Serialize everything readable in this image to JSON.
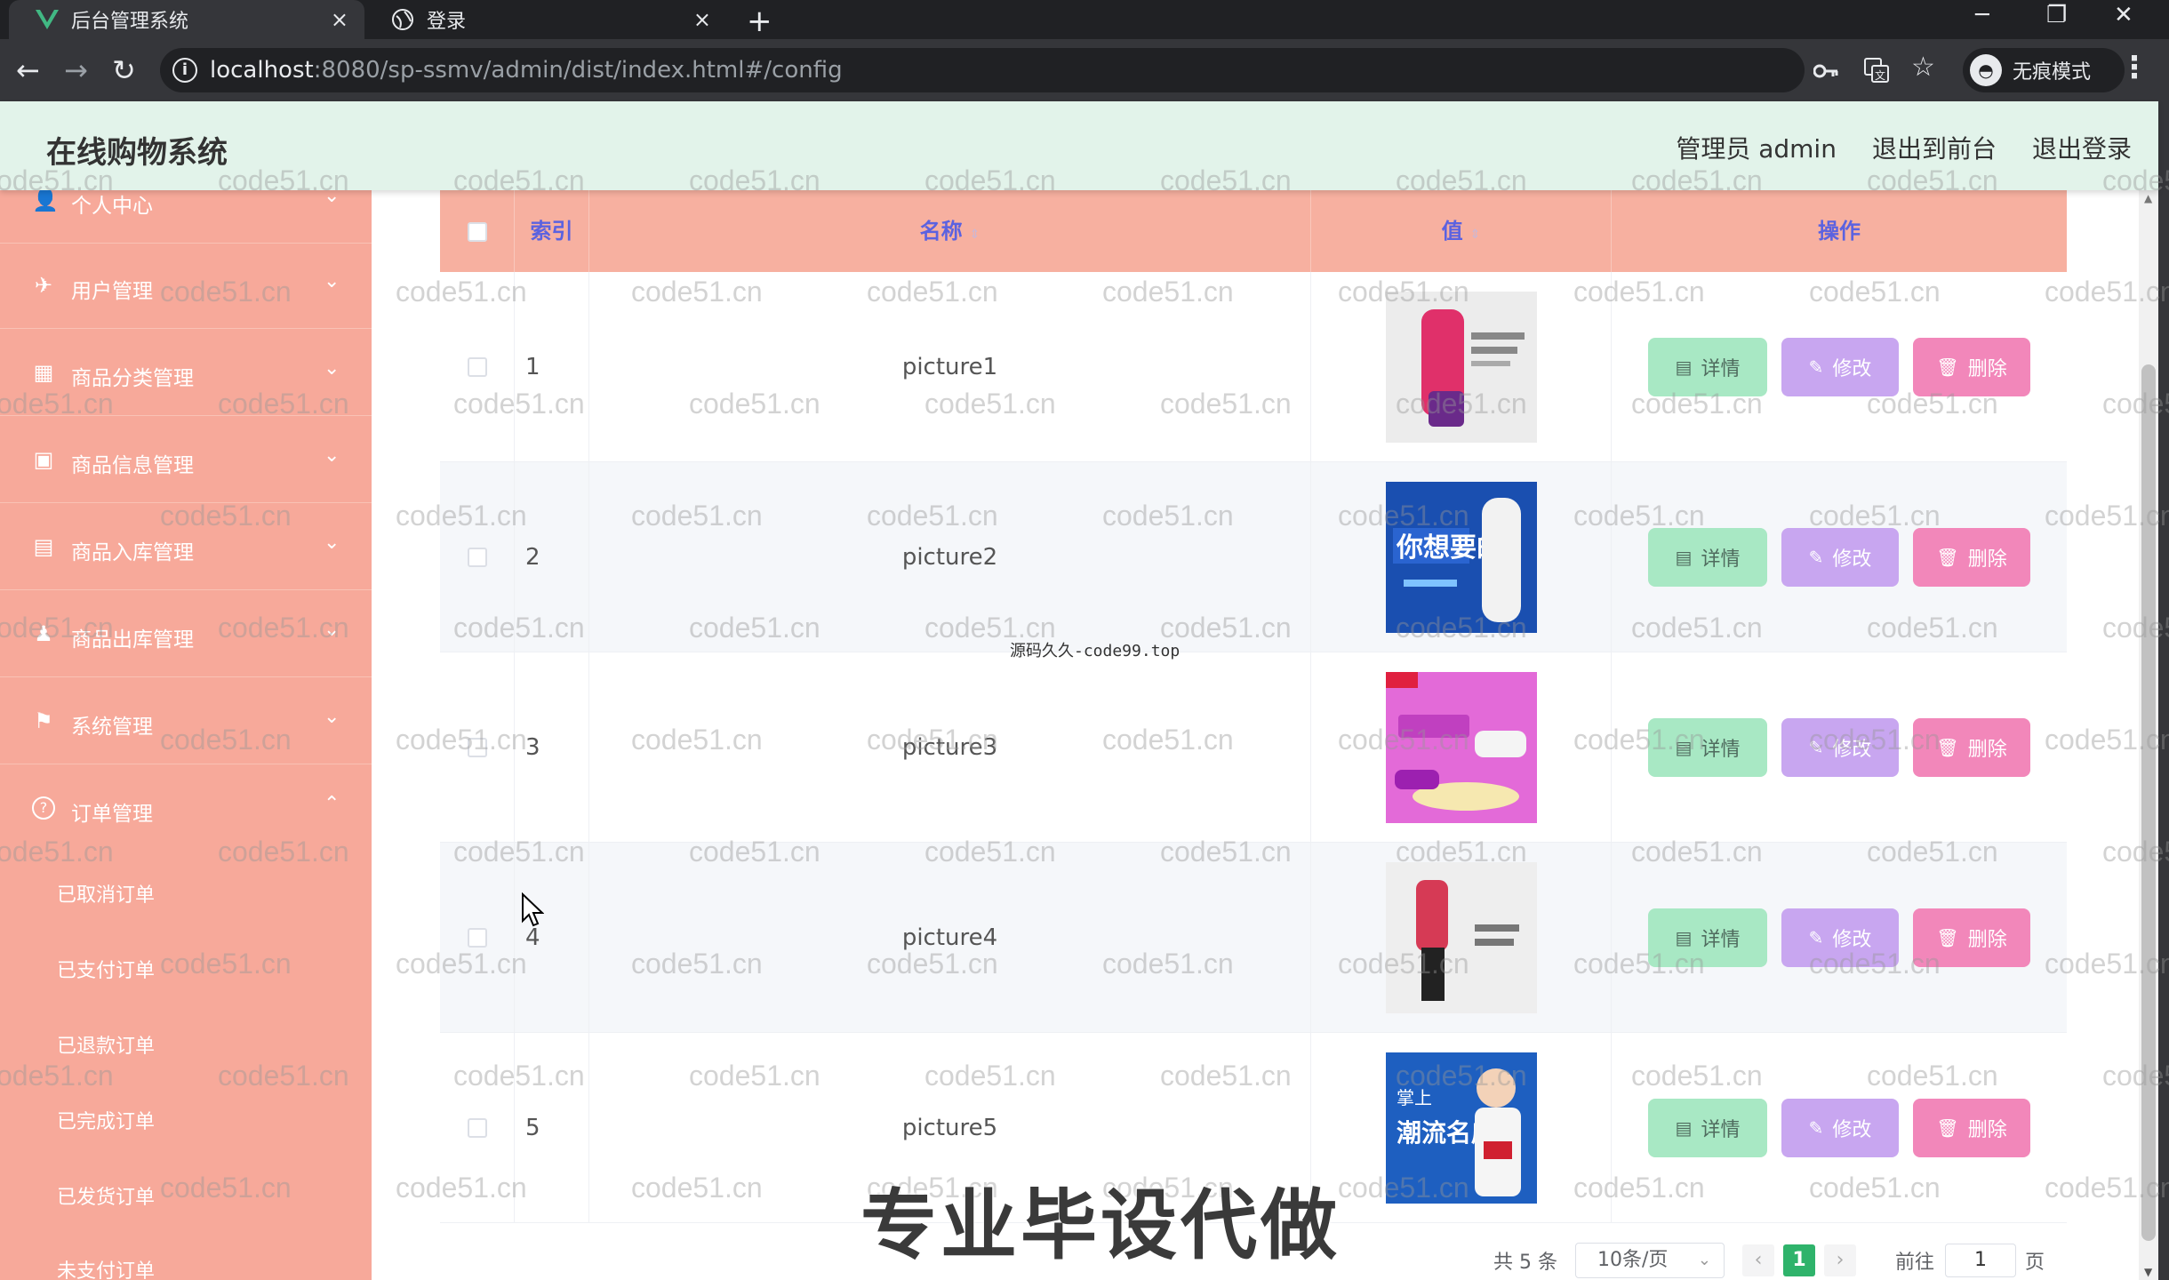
{
  "browser": {
    "tabs": [
      {
        "title": "后台管理系统",
        "close": "×"
      },
      {
        "title": "登录",
        "close": "×"
      }
    ],
    "new_tab": "+",
    "window": {
      "minimize": "─",
      "restore": "❐",
      "close": "✕"
    },
    "nav": {
      "back": "←",
      "forward": "→",
      "reload": "↻"
    },
    "url_host": "localhost",
    "url_rest": ":8080/sp-ssmv/admin/dist/index.html#/config",
    "incognito_label": "无痕模式"
  },
  "header": {
    "title": "在线购物系统",
    "links": [
      "管理员 admin",
      "退出到前台",
      "退出登录"
    ]
  },
  "sidebar": {
    "items": [
      {
        "label": "个人中心",
        "icon": "user-icon",
        "glyph": "👤",
        "chev": "⌄"
      },
      {
        "label": "用户管理",
        "icon": "send-icon",
        "glyph": "✈",
        "chev": "⌄"
      },
      {
        "label": "商品分类管理",
        "icon": "grid-icon",
        "glyph": "▦",
        "chev": "⌄"
      },
      {
        "label": "商品信息管理",
        "icon": "clipboard-icon",
        "glyph": "▣",
        "chev": "⌄"
      },
      {
        "label": "商品入库管理",
        "icon": "ticket-icon",
        "glyph": "▤",
        "chev": "⌄"
      },
      {
        "label": "商品出库管理",
        "icon": "person-icon",
        "glyph": "♟",
        "chev": "⌄"
      },
      {
        "label": "系统管理",
        "icon": "flag-icon",
        "glyph": "⚑",
        "chev": "⌄"
      },
      {
        "label": "订单管理",
        "icon": "help-icon",
        "glyph": "?",
        "chev": "⌃"
      }
    ],
    "sub_items": [
      "已取消订单",
      "已支付订单",
      "已退款订单",
      "已完成订单",
      "已发货订单",
      "未支付订单"
    ]
  },
  "table": {
    "headers": {
      "index": "索引",
      "name": "名称",
      "value": "值",
      "actions": "操作"
    },
    "sort_glyph": "⇕",
    "rows": [
      {
        "index": "1",
        "name": "picture1"
      },
      {
        "index": "2",
        "name": "picture2"
      },
      {
        "index": "3",
        "name": "picture3"
      },
      {
        "index": "4",
        "name": "picture4"
      },
      {
        "index": "5",
        "name": "picture5"
      }
    ],
    "buttons": {
      "detail": "详情",
      "edit": "修改",
      "delete": "删除"
    }
  },
  "pagination": {
    "total": "共 5 条",
    "page_size": "10条/页",
    "prev": "‹",
    "current": "1",
    "next": "›",
    "goto_label": "前往",
    "goto_value": "1",
    "page_unit": "页"
  },
  "overlay": {
    "watermark": "code51.cn",
    "center_text": "源码久久-code99.top",
    "big_text": "专业毕设代做"
  },
  "colors": {
    "sidebar": "#f7a99a",
    "table_header": "#f7b0a0",
    "header_bg": "#e2f3ea",
    "detail_btn": "#a8e8c4",
    "edit_btn": "#c8a6f0",
    "delete_btn": "#f287ba",
    "pager_active": "#2fb36b"
  }
}
